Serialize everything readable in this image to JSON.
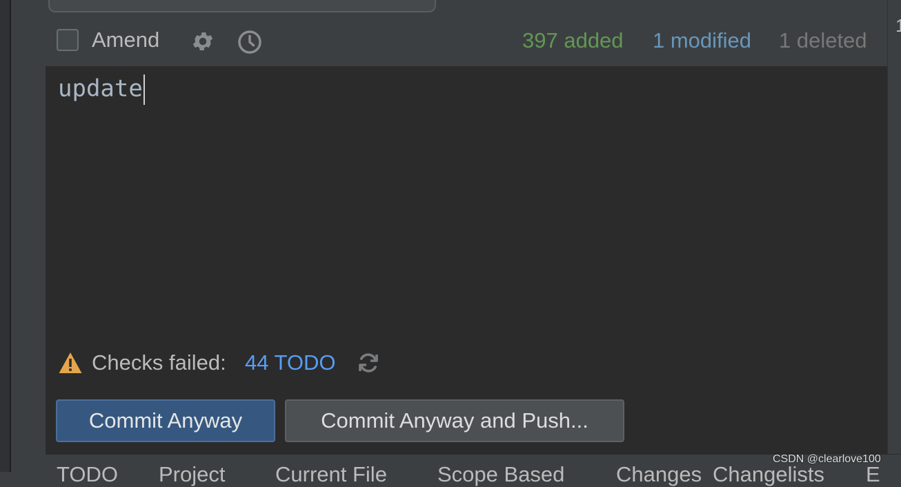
{
  "commit_panel": {
    "amend_label": "Amend",
    "amend_checked": false,
    "settings_icon": "gear-icon",
    "history_icon": "clock-icon",
    "stats": {
      "added": "397 added",
      "modified": "1 modified",
      "deleted": "1 deleted"
    },
    "colors": {
      "added": "#629755",
      "modified": "#6897bb",
      "deleted": "#787878",
      "link": "#589df6",
      "primary_button": "#365880"
    }
  },
  "editor": {
    "message": "update"
  },
  "checks": {
    "warning_icon": "warning-icon",
    "label": "Checks failed:",
    "link_text": "44 TODO",
    "refresh_icon": "refresh-icon"
  },
  "buttons": {
    "commit_anyway": "Commit Anyway",
    "commit_anyway_push": "Commit Anyway and Push..."
  },
  "bottom_tabs": [
    "TODO",
    "Project",
    "Current File",
    "Scope Based",
    "Changes",
    "Changelists",
    "E"
  ],
  "watermark": "CSDN @clearlove100"
}
